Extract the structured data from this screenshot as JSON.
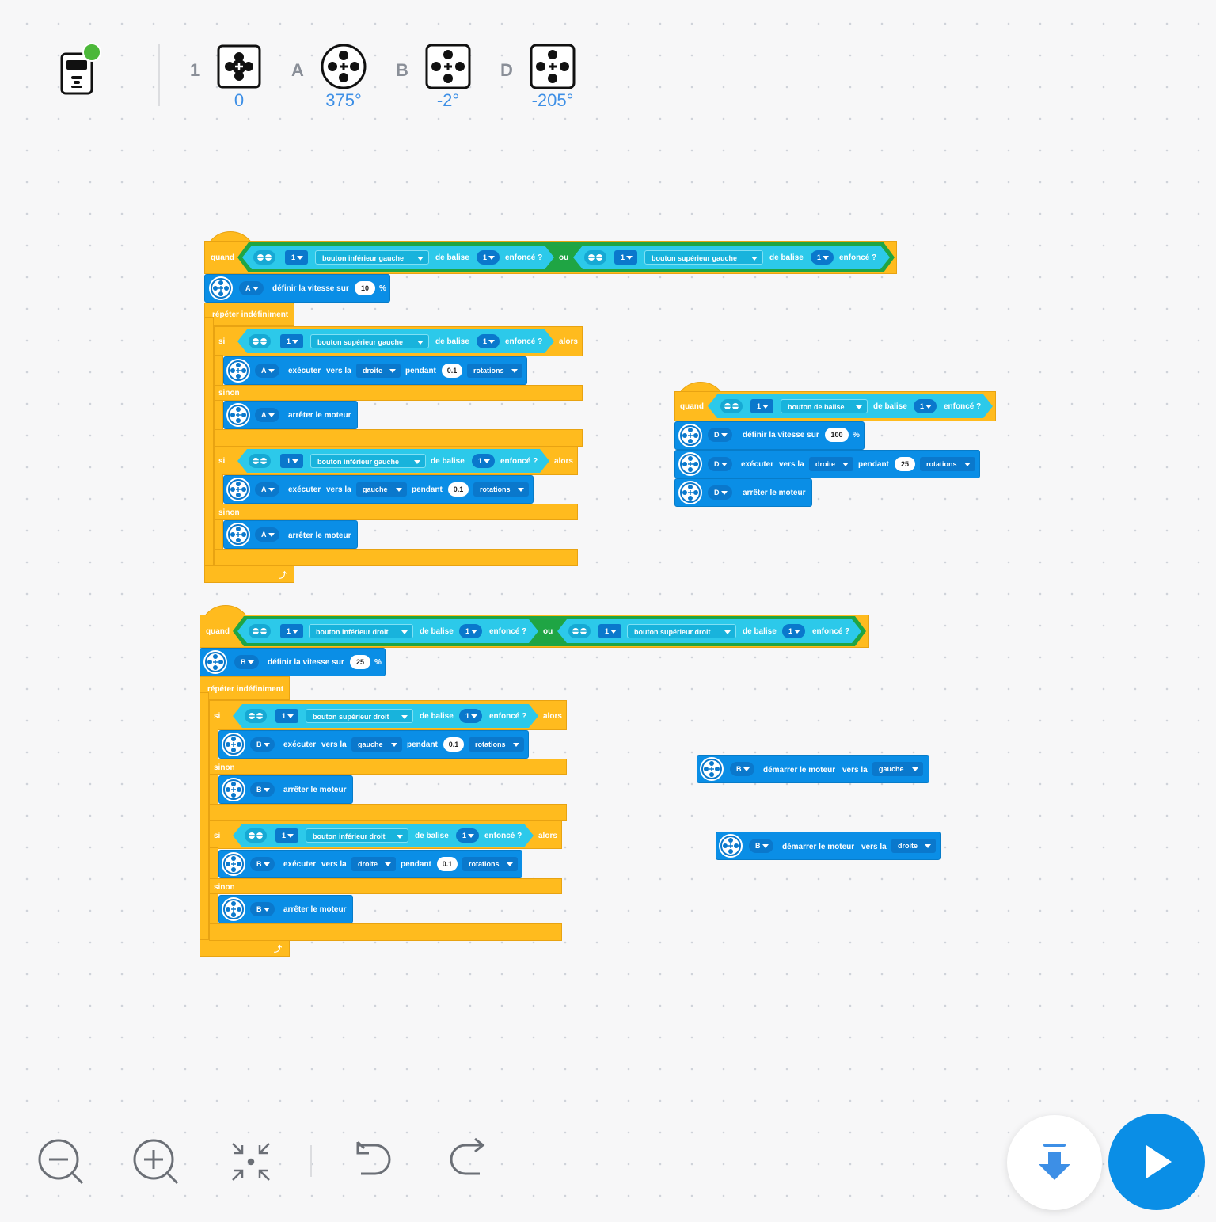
{
  "device_bar": {
    "hub_status": "connected",
    "ports": [
      {
        "port": "1",
        "kind": "beacon",
        "value": "0"
      },
      {
        "port": "A",
        "kind": "motor",
        "value": "375°"
      },
      {
        "port": "B",
        "kind": "motor",
        "value": "-2°"
      },
      {
        "port": "D",
        "kind": "motor",
        "value": "-205°"
      }
    ]
  },
  "labels": {
    "when": "quand",
    "or": "ou",
    "forever": "répéter indéfiniment",
    "if": "si",
    "then": "alors",
    "else": "sinon",
    "of_beacon": "de balise",
    "pressed": "enfoncé ?",
    "set_speed": "définir la vitesse sur",
    "percent": "%",
    "run": "exécuter",
    "towards": "vers la",
    "for": "pendant",
    "stop_motor": "arrêter le moteur",
    "start_motor": "démarrer le moteur"
  },
  "script1": {
    "btn_a": "bouton inférieur gauche",
    "btn_b": "bouton supérieur gauche",
    "one": "1",
    "motor": "A",
    "speed": "10",
    "if1_btn": "bouton supérieur gauche",
    "if1_dir": "droite",
    "if1_amount": "0.1",
    "if1_unit": "rotations",
    "if2_btn": "bouton inférieur gauche",
    "if2_dir": "gauche",
    "if2_amount": "0.1",
    "if2_unit": "rotations"
  },
  "script2": {
    "btn_a": "bouton inférieur droit",
    "btn_b": "bouton supérieur droit",
    "one": "1",
    "motor": "B",
    "speed": "25",
    "if1_btn": "bouton supérieur droit",
    "if1_dir": "gauche",
    "if1_amount": "0.1",
    "if1_unit": "rotations",
    "if2_btn": "bouton inférieur droit",
    "if2_dir": "droite",
    "if2_amount": "0.1",
    "if2_unit": "rotations"
  },
  "script3": {
    "btn": "bouton de balise",
    "one": "1",
    "motor": "D",
    "speed": "100",
    "dir": "droite",
    "amount": "25",
    "unit": "rotations"
  },
  "loose1": {
    "motor": "B",
    "dir": "gauche"
  },
  "loose2": {
    "motor": "B",
    "dir": "droite"
  },
  "colors": {
    "events": "#ffbb1e",
    "motor": "#0a8ee6",
    "sensor": "#2cc9ea",
    "operator": "#1fa544",
    "run": "#0a8ee6"
  },
  "toolbar": [
    "zoom-out",
    "zoom-in",
    "fit",
    "undo",
    "redo",
    "download",
    "run"
  ]
}
